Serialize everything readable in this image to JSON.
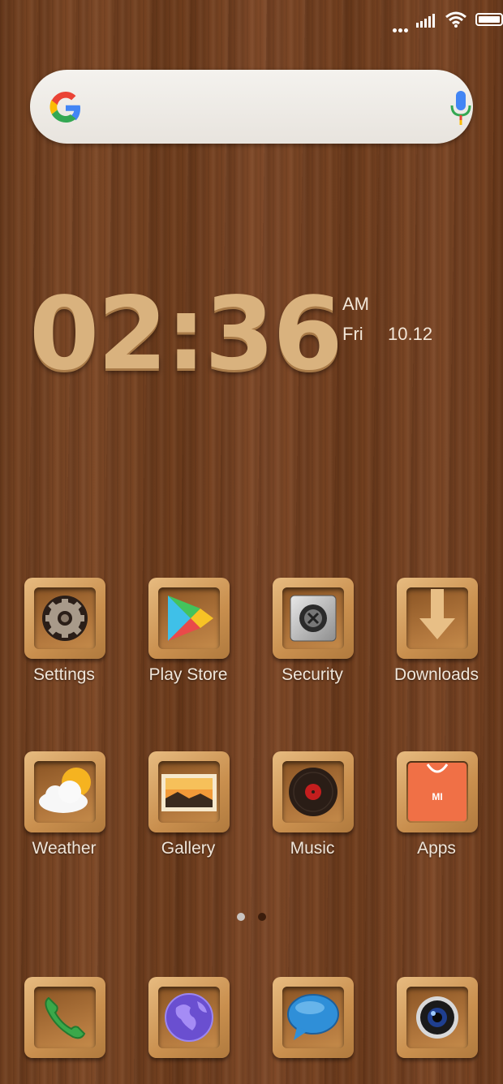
{
  "status_bar": {
    "battery_level": 1.0
  },
  "search": {
    "placeholder": ""
  },
  "clock": {
    "time": "02:36",
    "ampm": "AM",
    "day": "Fri",
    "date": "10.12"
  },
  "apps": [
    {
      "label": "Settings",
      "icon": "gear-icon"
    },
    {
      "label": "Play Store",
      "icon": "play-store-icon"
    },
    {
      "label": "Security",
      "icon": "safe-icon"
    },
    {
      "label": "Downloads",
      "icon": "download-arrow-icon"
    },
    {
      "label": "Weather",
      "icon": "sun-cloud-icon"
    },
    {
      "label": "Gallery",
      "icon": "picture-icon"
    },
    {
      "label": "Music",
      "icon": "vinyl-record-icon"
    },
    {
      "label": "Apps",
      "icon": "shopping-bag-icon"
    }
  ],
  "dock": [
    {
      "icon": "phone-icon"
    },
    {
      "icon": "globe-browser-icon"
    },
    {
      "icon": "chat-bubble-icon"
    },
    {
      "icon": "camera-icon"
    }
  ],
  "pager": {
    "pages": 2,
    "current": 1
  },
  "colors": {
    "wood": "#744222",
    "tile_light": "#e7bb80",
    "accent_orange": "#f07046"
  }
}
